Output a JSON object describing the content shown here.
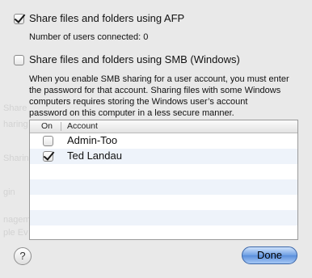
{
  "afp": {
    "checked": true,
    "label": "Share files and folders using AFP",
    "users_connected": "Number of users connected: 0"
  },
  "smb": {
    "checked": false,
    "label": "Share files and folders using SMB (Windows)",
    "description_lines": [
      "When you enable SMB sharing for a user account, you must enter",
      "the password for that account. Sharing files with some Windows",
      "computers requires storing the Windows user’s account",
      "password on this computer in a less secure manner."
    ]
  },
  "accounts_table": {
    "columns": [
      "On",
      "Account"
    ],
    "rows": [
      {
        "on": false,
        "account": "Admin-Too"
      },
      {
        "on": true,
        "account": "Ted Landau"
      }
    ]
  },
  "buttons": {
    "help_label": "?",
    "done_label": "Done"
  },
  "colors": {
    "default_button": "#6e9fe3",
    "alt_row": "#eef3fa",
    "sheet_background": "#e9e9e9"
  }
}
